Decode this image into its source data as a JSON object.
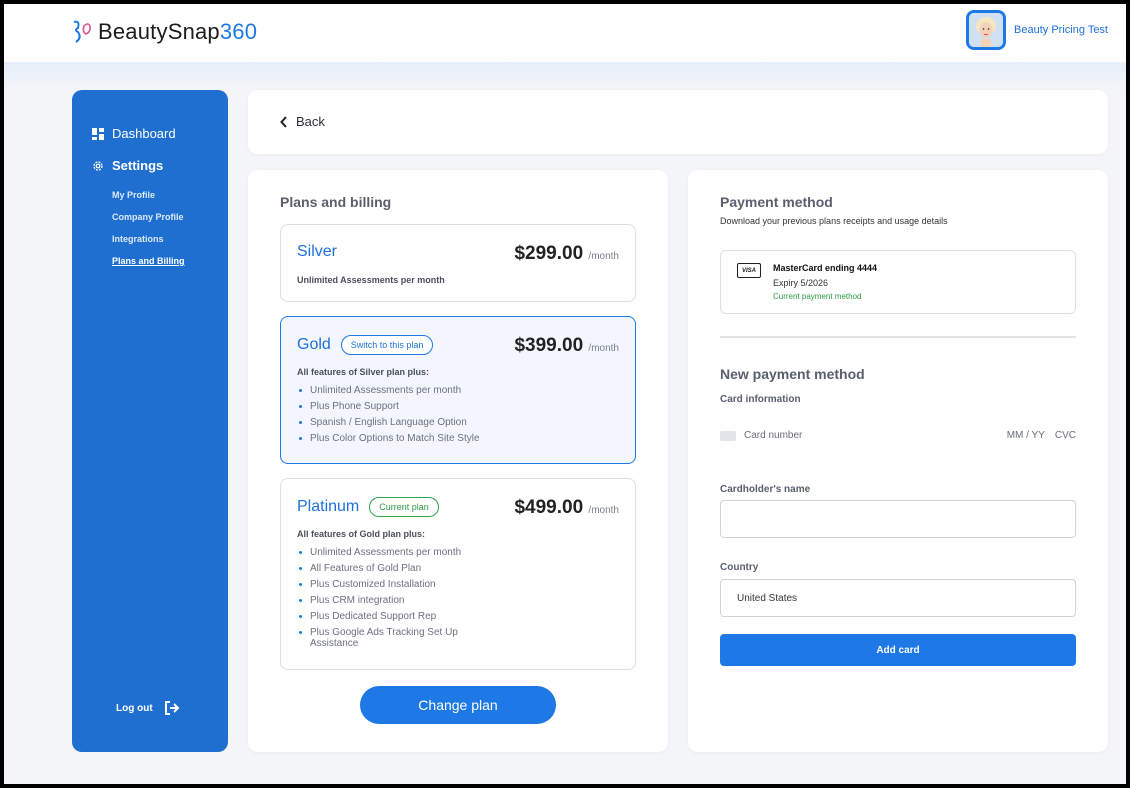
{
  "header": {
    "logo_text": "BeautySnap",
    "logo_num": "360",
    "user_name": "Beauty Pricing Test"
  },
  "sidebar": {
    "dashboard": "Dashboard",
    "settings": "Settings",
    "items": [
      {
        "label": "My Profile"
      },
      {
        "label": "Company Profile"
      },
      {
        "label": "Integrations"
      },
      {
        "label": "Plans and Billing"
      }
    ],
    "logout": "Log out"
  },
  "back_label": "Back",
  "plans": {
    "title": "Plans and billing",
    "silver": {
      "name": "Silver",
      "price": "$299.00",
      "per": "/month",
      "desc": "Unlimited Assessments per month"
    },
    "gold": {
      "name": "Gold",
      "badge": "Switch to this plan",
      "price": "$399.00",
      "per": "/month",
      "desc": "All features of Silver plan plus:",
      "features": [
        "Unlimited Assessments per month",
        "Plus Phone Support",
        "Spanish / English Language Option",
        "Plus Color Options to Match Site Style"
      ]
    },
    "platinum": {
      "name": "Platinum",
      "badge": "Current plan",
      "price": "$499.00",
      "per": "/month",
      "desc": "All features of Gold plan plus:",
      "features": [
        "Unlimited Assessments per month",
        "All Features of Gold Plan",
        "Plus Customized Installation",
        "Plus CRM integration",
        "Plus Dedicated Support Rep",
        "Plus Google Ads Tracking Set Up Assistance"
      ]
    },
    "change_button": "Change plan"
  },
  "payment": {
    "title": "Payment method",
    "subtitle": "Download your previous plans receipts and usage details",
    "saved_card": {
      "brand": "VISA",
      "name": "MasterCard ending 4444",
      "expiry": "Expiry 5/2026",
      "status": "Current payment method"
    },
    "new_title": "New payment method",
    "card_info_label": "Card information",
    "card_number_placeholder": "Card number",
    "expiry_placeholder": "MM / YY",
    "cvc_placeholder": "CVC",
    "cardholder_label": "Cardholder's name",
    "cardholder_value": "",
    "country_label": "Country",
    "country_value": "United States",
    "add_button": "Add card"
  },
  "colors": {
    "primary": "#1e78e6",
    "sidebar": "#1f6fd0",
    "success": "#2a9a44"
  }
}
